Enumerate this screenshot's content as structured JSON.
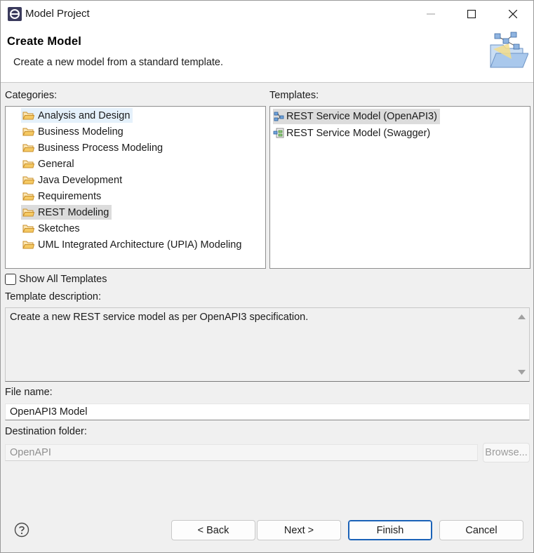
{
  "window": {
    "title": "Model Project",
    "icons": {
      "app": "eclipse-app-icon",
      "minimize": "minimize-icon",
      "maximize": "maximize-icon",
      "close": "close-icon"
    }
  },
  "banner": {
    "title": "Create Model",
    "description": "Create a new model from a standard template.",
    "graphic": "new-model-folder-graphic"
  },
  "categories": {
    "label": "Categories:",
    "items": [
      {
        "label": "Analysis and Design",
        "icon": "folder-icon",
        "state": "hover"
      },
      {
        "label": "Business Modeling",
        "icon": "folder-icon"
      },
      {
        "label": "Business Process Modeling",
        "icon": "folder-icon"
      },
      {
        "label": "General",
        "icon": "folder-icon"
      },
      {
        "label": "Java Development",
        "icon": "folder-icon"
      },
      {
        "label": "Requirements",
        "icon": "folder-icon"
      },
      {
        "label": "REST Modeling",
        "icon": "folder-icon",
        "state": "selected"
      },
      {
        "label": "Sketches",
        "icon": "folder-icon"
      },
      {
        "label": "UML Integrated Architecture (UPIA) Modeling",
        "icon": "folder-icon"
      }
    ]
  },
  "templates": {
    "label": "Templates:",
    "items": [
      {
        "label": "REST Service Model (OpenAPI3)",
        "icon": "rest-model-icon",
        "state": "selected"
      },
      {
        "label": "REST Service Model (Swagger)",
        "icon": "rest-swagger-model-icon"
      }
    ]
  },
  "show_all_templates": {
    "label": "Show All Templates",
    "checked": false
  },
  "template_description": {
    "label": "Template description:",
    "text": "Create a new REST service model as per OpenAPI3 specification."
  },
  "file_name": {
    "label": "File name:",
    "value": "OpenAPI3 Model"
  },
  "destination_folder": {
    "label": "Destination folder:",
    "value": "OpenAPI",
    "browse_label": "Browse..."
  },
  "buttons": {
    "back": "< Back",
    "next": "Next >",
    "finish": "Finish",
    "cancel": "Cancel"
  },
  "colors": {
    "accent": "#1a62b8",
    "folder": "#e8b24a",
    "selection": "#dcdcdc"
  }
}
